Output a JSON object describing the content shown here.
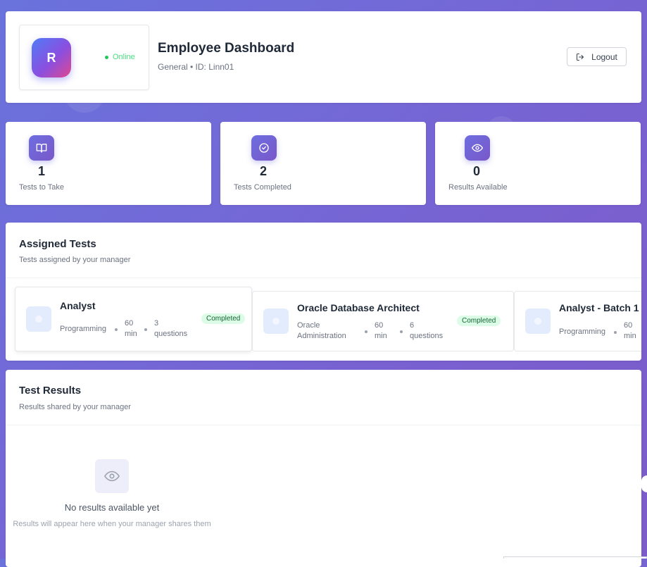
{
  "header": {
    "avatar_initial": "R",
    "status": "Online",
    "title": "Employee Dashboard",
    "subtitle": "General • ID: Linn01",
    "logout_label": "Logout"
  },
  "stats": [
    {
      "value": "1",
      "label": "Tests to Take",
      "icon": "book-icon"
    },
    {
      "value": "2",
      "label": "Tests Completed",
      "icon": "check-circle-icon"
    },
    {
      "value": "0",
      "label": "Results Available",
      "icon": "eye-icon"
    }
  ],
  "assigned": {
    "title": "Assigned Tests",
    "subtitle": "Tests assigned by your manager",
    "tests": [
      {
        "name": "Analyst",
        "category": "Programming",
        "duration": "60 min",
        "questions": "3 questions",
        "status": "Completed"
      },
      {
        "name": "Oracle Database Architect",
        "category": "Oracle Administration",
        "duration": "60 min",
        "questions": "6 questions",
        "status": "Completed"
      },
      {
        "name": "Analyst - Batch 1",
        "category": "Programming",
        "duration": "60 min",
        "questions": "",
        "status": ""
      }
    ]
  },
  "results": {
    "title": "Test Results",
    "subtitle": "Results shared by your manager",
    "empty_title": "No results available yet",
    "empty_subtitle": "Results will appear here when your manager shares them"
  },
  "colors": {
    "accent": "#6d6ee0",
    "online": "#22c55e",
    "badge_bg": "#dcfce7",
    "badge_text": "#166534"
  }
}
